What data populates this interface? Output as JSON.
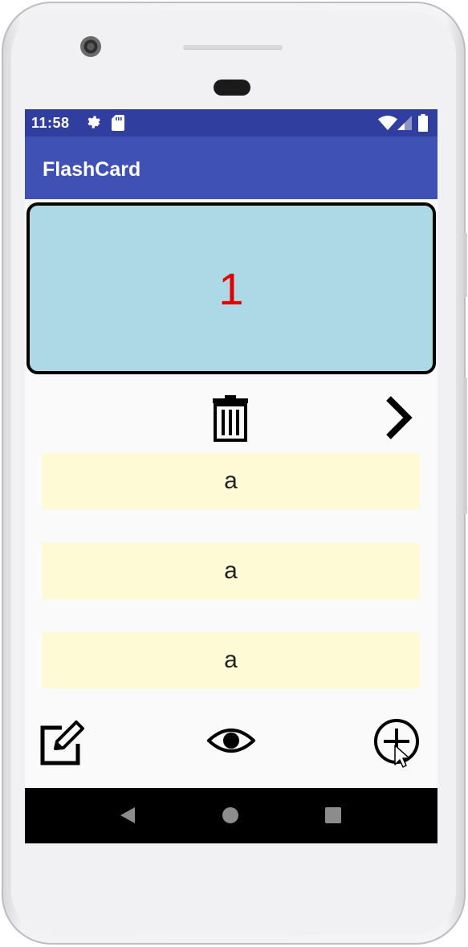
{
  "status_bar": {
    "time": "11:58",
    "icons": [
      "settings-icon",
      "sd-card-icon",
      "wifi-icon",
      "signal-icon",
      "battery-icon"
    ]
  },
  "app_bar": {
    "title": "FlashCard"
  },
  "card": {
    "text": "1",
    "text_color": "#e00000",
    "background": "#add8e6"
  },
  "card_actions": {
    "delete_icon": "trash-icon",
    "next_icon": "chevron-right-icon"
  },
  "answers": [
    {
      "text": "a"
    },
    {
      "text": "a"
    },
    {
      "text": "a"
    }
  ],
  "bottom_actions": [
    "edit-icon",
    "eye-icon",
    "add-circle-icon"
  ],
  "nav_bar": [
    "back-icon",
    "home-icon",
    "recents-icon"
  ],
  "colors": {
    "status_bar": "#303f9f",
    "app_bar": "#3f51b5",
    "answer_bg": "#fffad6"
  }
}
